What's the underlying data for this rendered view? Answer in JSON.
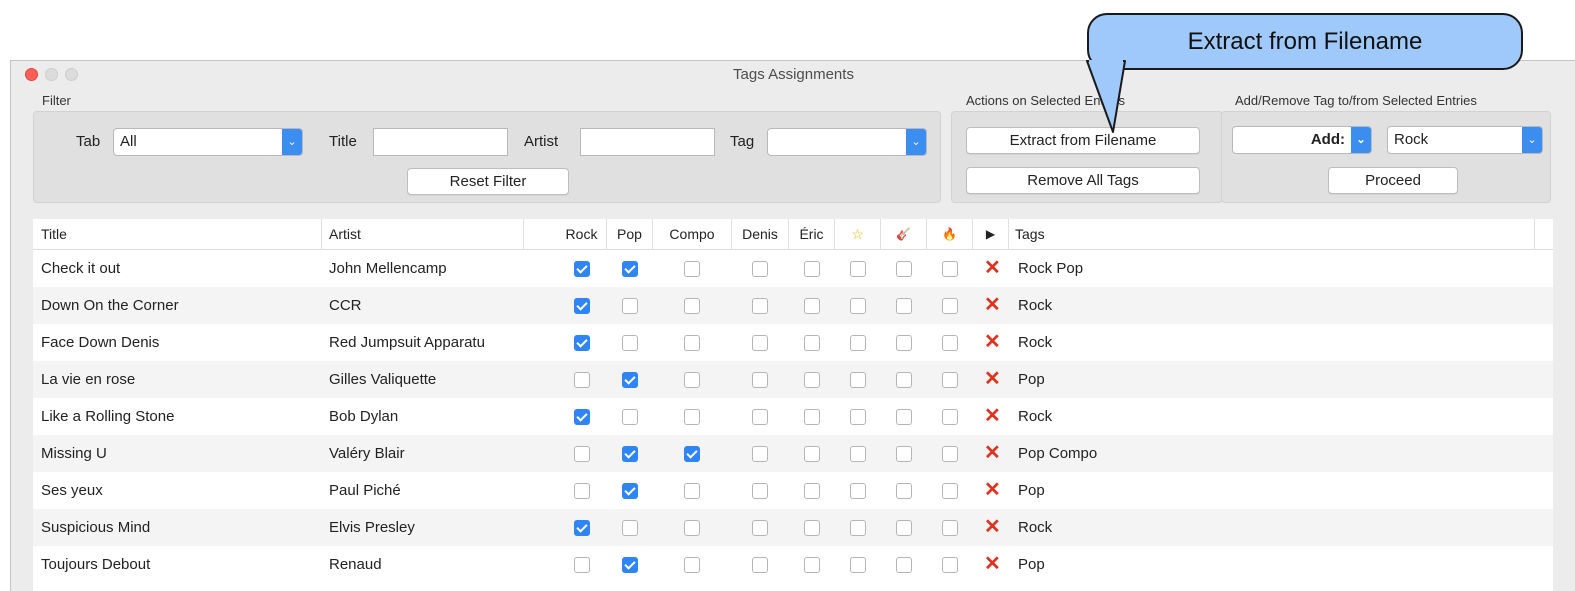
{
  "callout": {
    "text": "Extract from Filename"
  },
  "window": {
    "title": "Tags Assignments"
  },
  "filter": {
    "group_label": "Filter",
    "tab_label": "Tab",
    "tab_value": "All",
    "title_label": "Title",
    "title_value": "",
    "artist_label": "Artist",
    "artist_value": "",
    "tag_label": "Tag",
    "tag_value": "",
    "reset_label": "Reset Filter"
  },
  "actions": {
    "group_label": "Actions on Selected Entries",
    "extract_label": "Extract from Filename",
    "remove_label": "Remove All Tags"
  },
  "addremove": {
    "group_label": "Add/Remove Tag to/from Selected Entries",
    "mode_value": "Add:",
    "tag_value": "Rock",
    "proceed_label": "Proceed"
  },
  "table": {
    "headers": {
      "title": "Title",
      "artist": "Artist",
      "rock": "Rock",
      "pop": "Pop",
      "compo": "Compo",
      "denis": "Denis",
      "eric": "Éric",
      "star": "☆",
      "guitar": "🎸",
      "fire": "🔥",
      "play": "▶",
      "tags": "Tags"
    },
    "rows": [
      {
        "title": "Check it out",
        "artist": "John Mellencamp",
        "checks": [
          true,
          true,
          false,
          false,
          false,
          false,
          false,
          false
        ],
        "tags": "Rock Pop"
      },
      {
        "title": "Down On the Corner",
        "artist": "CCR",
        "checks": [
          true,
          false,
          false,
          false,
          false,
          false,
          false,
          false
        ],
        "tags": "Rock"
      },
      {
        "title": "Face Down Denis",
        "artist": "Red Jumpsuit Apparatu",
        "checks": [
          true,
          false,
          false,
          false,
          false,
          false,
          false,
          false
        ],
        "tags": "Rock"
      },
      {
        "title": "La vie en rose",
        "artist": "Gilles Valiquette",
        "checks": [
          false,
          true,
          false,
          false,
          false,
          false,
          false,
          false
        ],
        "tags": "Pop"
      },
      {
        "title": "Like a Rolling Stone",
        "artist": "Bob Dylan",
        "checks": [
          true,
          false,
          false,
          false,
          false,
          false,
          false,
          false
        ],
        "tags": "Rock"
      },
      {
        "title": "Missing U",
        "artist": "Valéry Blair",
        "checks": [
          false,
          true,
          true,
          false,
          false,
          false,
          false,
          false
        ],
        "tags": "Pop Compo"
      },
      {
        "title": "Ses yeux",
        "artist": "Paul Piché",
        "checks": [
          false,
          true,
          false,
          false,
          false,
          false,
          false,
          false
        ],
        "tags": "Pop"
      },
      {
        "title": "Suspicious Mind",
        "artist": "Elvis Presley",
        "checks": [
          true,
          false,
          false,
          false,
          false,
          false,
          false,
          false
        ],
        "tags": "Rock"
      },
      {
        "title": "Toujours Debout",
        "artist": "Renaud",
        "checks": [
          false,
          true,
          false,
          false,
          false,
          false,
          false,
          false
        ],
        "tags": "Pop"
      }
    ],
    "delete_glyph": "✕"
  },
  "colors": {
    "accent": "#2f85f6",
    "delete": "#e0321e",
    "callout": "#9ec9fa"
  }
}
